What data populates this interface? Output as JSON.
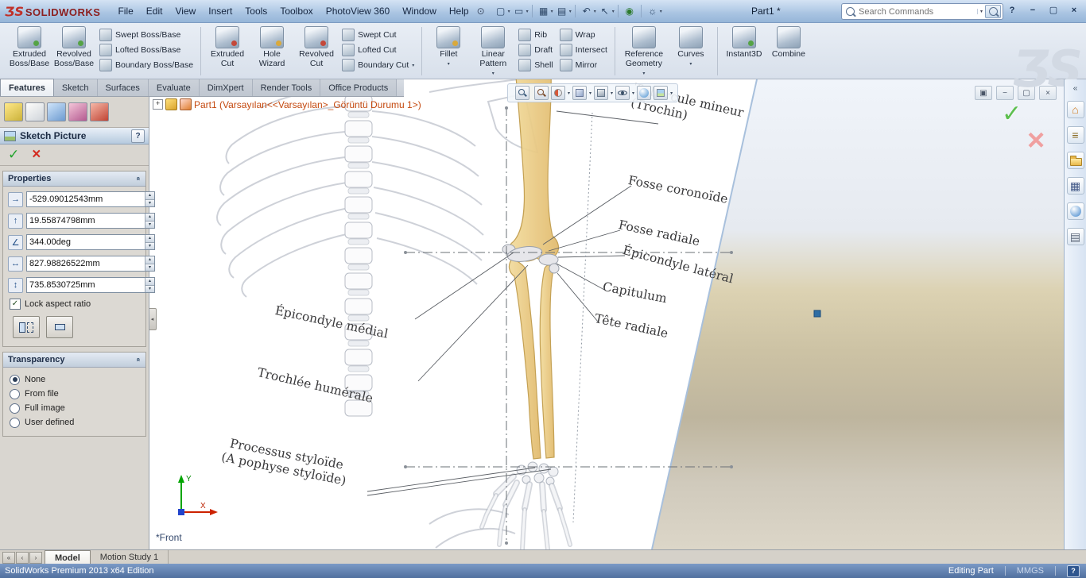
{
  "titlebar": {
    "logo": {
      "mark": "ƷS",
      "name": "SOLIDWORKS"
    },
    "menus": [
      "File",
      "Edit",
      "View",
      "Insert",
      "Tools",
      "Toolbox",
      "PhotoView 360",
      "Window",
      "Help"
    ],
    "document_title": "Part1 *",
    "search_placeholder": "Search Commands"
  },
  "ribbon": {
    "active_tab": "Features",
    "tabs": [
      "Features",
      "Sketch",
      "Surfaces",
      "Evaluate",
      "DimXpert",
      "Render Tools",
      "Office Products"
    ],
    "watermark": "ƷS",
    "groups": [
      {
        "large": [
          {
            "label": "Extruded\nBoss/Base"
          },
          {
            "label": "Revolved\nBoss/Base"
          }
        ],
        "small": [
          {
            "label": "Swept Boss/Base"
          },
          {
            "label": "Lofted Boss/Base"
          },
          {
            "label": "Boundary Boss/Base"
          }
        ]
      },
      {
        "large": [
          {
            "label": "Extruded\nCut"
          },
          {
            "label": "Hole\nWizard"
          },
          {
            "label": "Revolved\nCut"
          }
        ],
        "small": [
          {
            "label": "Swept Cut"
          },
          {
            "label": "Lofted Cut"
          },
          {
            "label": "Boundary Cut"
          }
        ]
      },
      {
        "large": [
          {
            "label": "Fillet"
          },
          {
            "label": "Linear\nPattern"
          }
        ],
        "small": [
          {
            "label": "Rib"
          },
          {
            "label": "Draft"
          },
          {
            "label": "Shell"
          }
        ],
        "small2": [
          {
            "label": "Wrap"
          },
          {
            "label": "Intersect"
          },
          {
            "label": "Mirror"
          }
        ]
      },
      {
        "large": [
          {
            "label": "Reference\nGeometry"
          },
          {
            "label": "Curves"
          }
        ]
      },
      {
        "large": [
          {
            "label": "Instant3D"
          },
          {
            "label": "Combine"
          }
        ]
      }
    ]
  },
  "panel": {
    "title": "Sketch Picture",
    "groups": {
      "properties": {
        "label": "Properties"
      },
      "transparency": {
        "label": "Transparency"
      }
    },
    "fields": [
      {
        "name": "x-position",
        "glyph": "→",
        "value": "-529.09012543mm"
      },
      {
        "name": "y-position",
        "glyph": "↑",
        "value": "19.55874798mm"
      },
      {
        "name": "angle",
        "glyph": "∠",
        "value": "344.00deg"
      },
      {
        "name": "width",
        "glyph": "↔",
        "value": "827.98826522mm"
      },
      {
        "name": "height",
        "glyph": "↕",
        "value": "735.8530725mm"
      }
    ],
    "lock_aspect_ratio": {
      "label": "Lock aspect ratio",
      "checked": true
    },
    "transparency_options": [
      {
        "label": "None",
        "selected": true
      },
      {
        "label": "From file",
        "selected": false
      },
      {
        "label": "Full image",
        "selected": false
      },
      {
        "label": "User defined",
        "selected": false
      }
    ]
  },
  "viewport": {
    "feature_tree": "Part1  (Varsayılan<<Varsayılan>_Görüntü Durumu 1>)",
    "plane_label": "*Front",
    "triad": {
      "x": "X",
      "y": "Y"
    },
    "anatomy_labels": [
      {
        "text": "Tubercule mineur\n(Trochin)"
      },
      {
        "text": "Fosse coronoïde"
      },
      {
        "text": "Fosse radiale"
      },
      {
        "text": "Épicondyle latéral"
      },
      {
        "text": "Capitulum"
      },
      {
        "text": "Tête radiale"
      },
      {
        "text": "Épicondyle médial"
      },
      {
        "text": "Trochlée humérale"
      },
      {
        "text": "Processus styloïde\n(A pophyse styloïde)"
      }
    ]
  },
  "bottom": {
    "tabs": [
      {
        "label": "Model",
        "active": true
      },
      {
        "label": "Motion Study 1",
        "active": false
      }
    ]
  },
  "statusbar": {
    "edition": "SolidWorks Premium 2013 x64 Edition",
    "mode": "Editing Part",
    "units": "MMGS"
  },
  "glyphs": {
    "check": "✓",
    "close": "×",
    "minimize": "−",
    "maximize": "▢",
    "restore": "▣",
    "help": "?",
    "dropdown": "▼",
    "ddsmall": "▾",
    "up": "▴",
    "down": "▾",
    "collapse": "«",
    "plus": "+",
    "home": "⌂",
    "library": "≡",
    "palette": "▦",
    "props": "▤",
    "new": "▢",
    "open": "▭",
    "save": "▦",
    "print": "▤",
    "undo": "↶",
    "redo": "↷",
    "select": "↖",
    "rebuild": "◉",
    "options": "☼",
    "pin": "⊙",
    "nav1": "«",
    "nav2": "‹",
    "nav3": "›"
  }
}
